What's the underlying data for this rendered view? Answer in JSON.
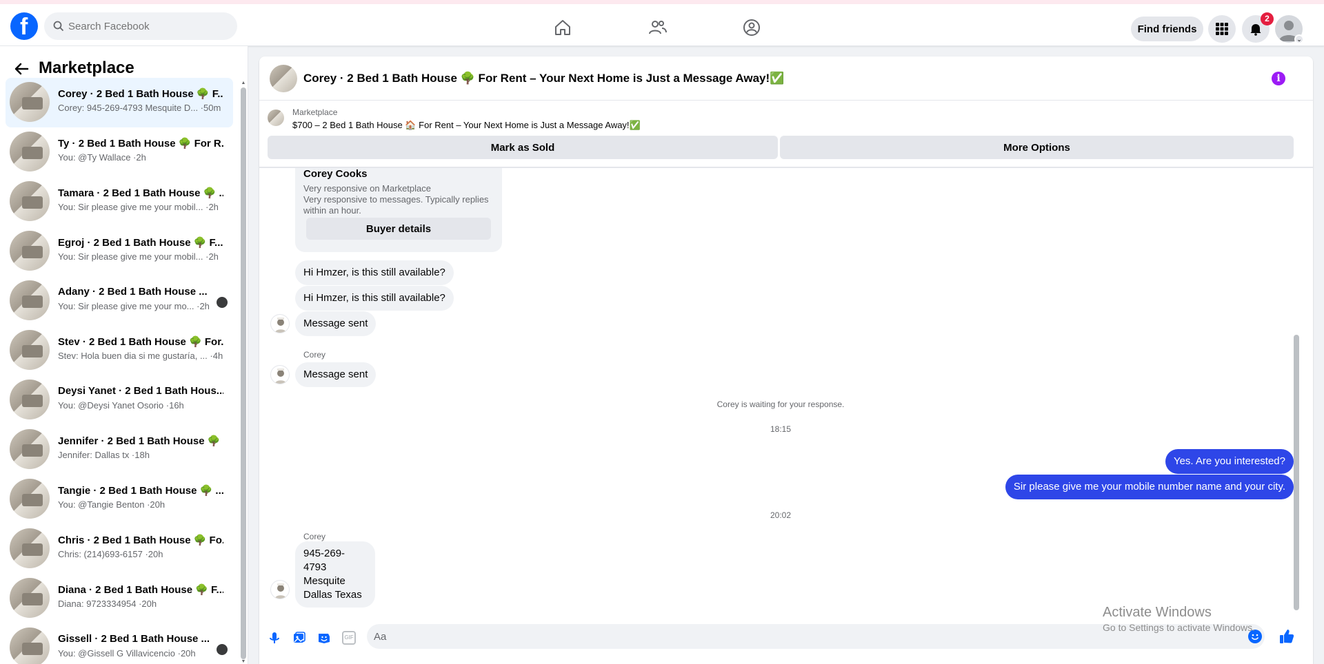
{
  "top_nav": {
    "logo_letter": "f",
    "search_placeholder": "Search Facebook",
    "find_friends": "Find friends",
    "notification_count": "2",
    "icons": [
      "home-icon",
      "friends-icon",
      "groups-icon",
      "menu-grid-icon",
      "bell-icon"
    ]
  },
  "sidebar": {
    "title": "Marketplace",
    "conversations": [
      {
        "title": "Corey · 2 Bed 1 Bath House 🌳 F...",
        "sub": "Corey: 945-269-4793 Mesquite D... ·50m",
        "active": true
      },
      {
        "title": "Ty · 2 Bed 1 Bath House 🌳 For R...",
        "sub": "You: @Ty Wallace ·2h"
      },
      {
        "title": "Tamara · 2 Bed 1 Bath House 🌳 ...",
        "sub": "You: Sir please give me your mobil... ·2h"
      },
      {
        "title": "Egroj · 2 Bed 1 Bath House 🌳 F...",
        "sub": "You: Sir please give me your mobil... ·2h"
      },
      {
        "title": "Adany · 2 Bed 1 Bath House ...",
        "sub": "You: Sir please give me your mo... ·2h"
      },
      {
        "title": "Stev · 2 Bed 1 Bath House 🌳 For...",
        "sub": "Stev: Hola buen dia si me gustaría, ... ·4h"
      },
      {
        "title": "Deysi Yanet · 2 Bed 1 Bath Hous...",
        "sub": "You: @Deysi Yanet Osorio ·16h"
      },
      {
        "title": "Jennifer · 2 Bed 1 Bath House 🌳 ...",
        "sub": "Jennifer: Dallas tx ·18h"
      },
      {
        "title": "Tangie · 2 Bed 1 Bath House 🌳 ...",
        "sub": "You: @Tangie Benton ·20h"
      },
      {
        "title": "Chris · 2 Bed 1 Bath House 🌳 Fo...",
        "sub": "Chris: (214)693-6157 ·20h"
      },
      {
        "title": "Diana · 2 Bed 1 Bath House 🌳 F...",
        "sub": "Diana: 9723334954 ·20h"
      },
      {
        "title": "Gissell · 2 Bed 1 Bath House ...",
        "sub": "You: @Gissell G Villavicencio ·20h"
      }
    ]
  },
  "conversation": {
    "title": "Corey · 2 Bed 1 Bath House 🌳 For Rent – Your Next Home is Just a Message Away!✅",
    "listing_category": "Marketplace",
    "listing_title": "$700 – 2 Bed 1 Bath House 🏠 For Rent – Your Next Home is Just a Message Away!✅",
    "mark_sold": "Mark as Sold",
    "more_options": "More Options",
    "card": {
      "name": "Corey Cooks",
      "line1": "Very responsive on Marketplace",
      "line2": "Very responsive to messages. Typically replies within an hour.",
      "buyer_details": "Buyer details"
    },
    "messages": {
      "m1": "Hi Hmzer, is this still available?",
      "m2": "Hi Hmzer, is this still available?",
      "m3": "Message sent",
      "sender1": "Corey",
      "m4": "Message sent",
      "waiting": "Corey is waiting for your response.",
      "time1": "18:15",
      "out1": "Yes. Are you interested?",
      "out2": "Sir please give me your mobile number name and your city.",
      "time2": "20:02",
      "sender2": "Corey",
      "m5_l1": "945-269-4793",
      "m5_l2": "Mesquite",
      "m5_l3": "Dallas Texas"
    },
    "composer_placeholder": "Aa",
    "gif_label": "GIF"
  },
  "watermark": {
    "line1": "Activate Windows",
    "line2": "Go to Settings to activate Windows."
  },
  "colors": {
    "brand": "#0866ff",
    "outgoing_bubble": "#2e46e8",
    "notification": "#e41e3f",
    "info": "#9c1bf5"
  }
}
